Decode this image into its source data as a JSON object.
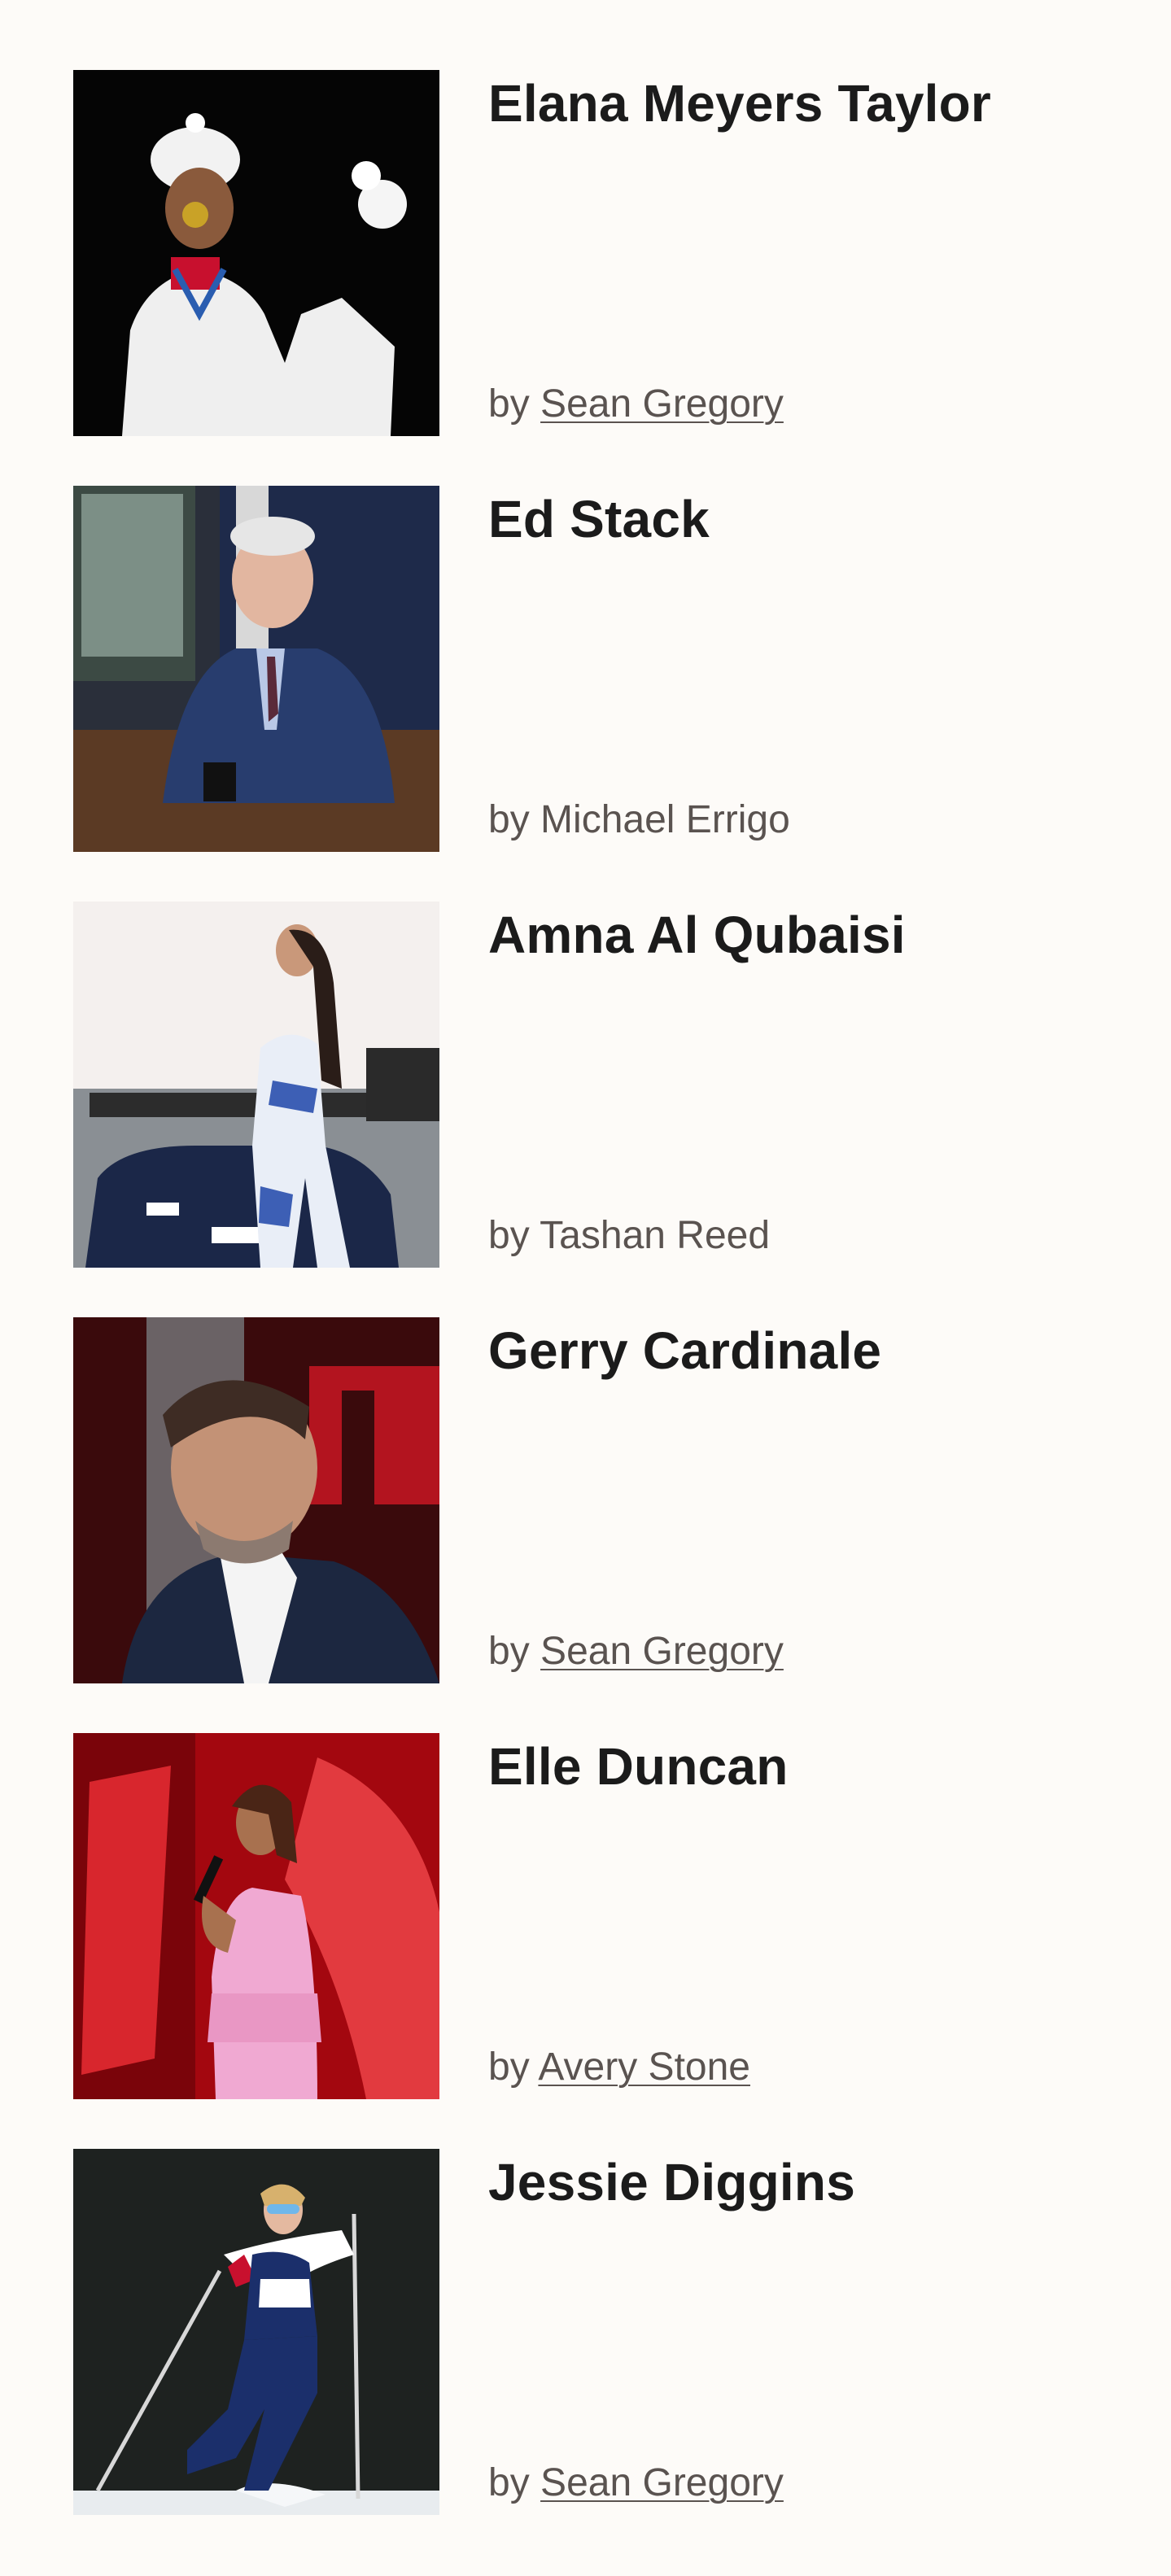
{
  "items": [
    {
      "name": "Elana Meyers Taylor",
      "by": "by",
      "author": "Sean Gregory",
      "author_linked": true
    },
    {
      "name": "Ed Stack",
      "by": "by",
      "author": "Michael Errigo",
      "author_linked": false
    },
    {
      "name": "Amna Al Qubaisi",
      "by": "by",
      "author": "Tashan Reed",
      "author_linked": false
    },
    {
      "name": "Gerry Cardinale",
      "by": "by",
      "author": "Sean Gregory",
      "author_linked": true
    },
    {
      "name": "Elle Duncan",
      "by": "by",
      "author": "Avery Stone",
      "author_linked": true
    },
    {
      "name": "Jessie Diggins",
      "by": "by",
      "author": "Sean Gregory",
      "author_linked": true
    }
  ],
  "colors": {
    "background": "#fdfbf8",
    "title": "#1b1b1b",
    "byline": "#5a5350"
  }
}
